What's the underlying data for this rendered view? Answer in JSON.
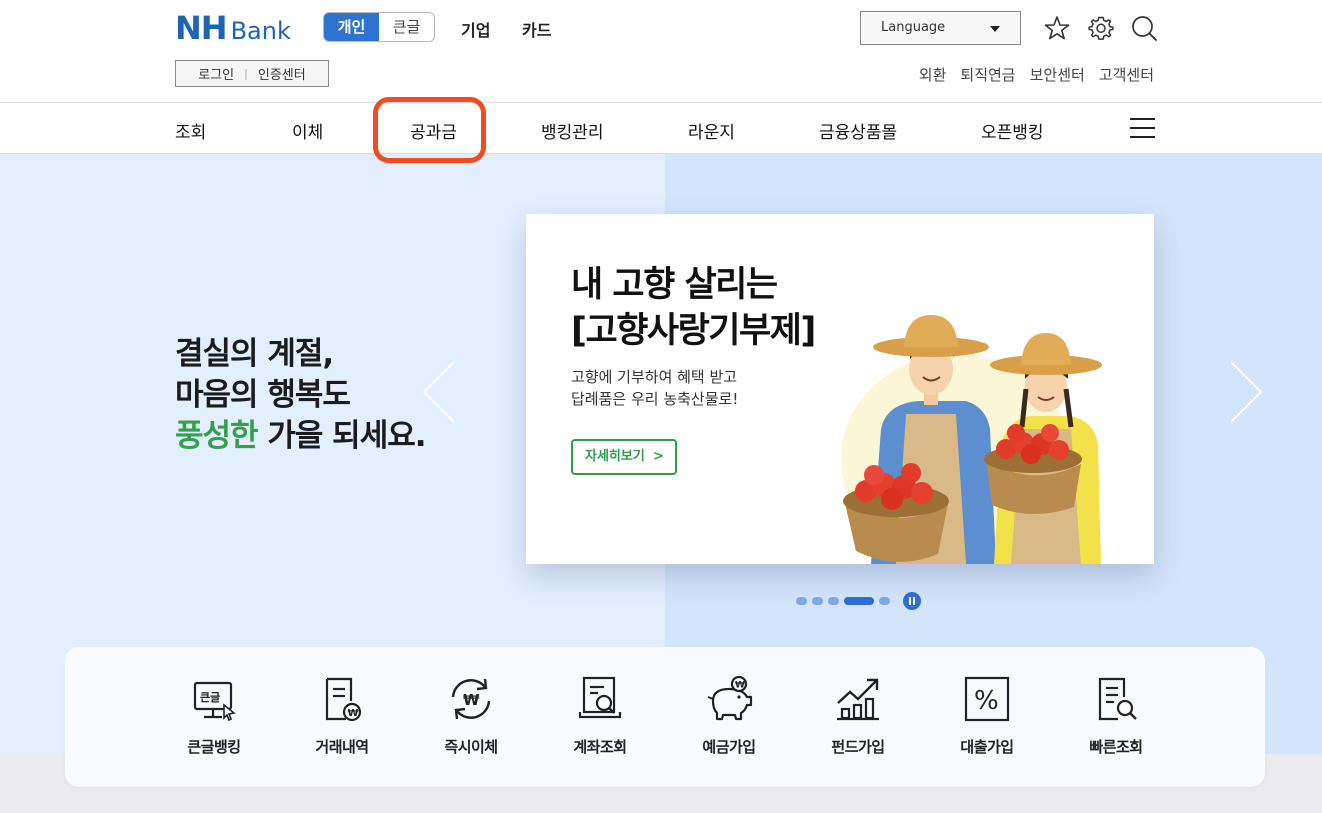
{
  "header": {
    "logo_nh": "NH",
    "logo_bank": "Bank",
    "segments": [
      {
        "label": "개인",
        "active": true
      },
      {
        "label": "큰글",
        "active": false
      }
    ],
    "top_links": [
      "기업",
      "카드"
    ],
    "language_label": "Language",
    "icons": [
      "star-icon",
      "gear-icon",
      "search-icon"
    ],
    "login_links": [
      "로그인",
      "인증센터"
    ],
    "util_links": [
      "외환",
      "퇴직연금",
      "보안센터",
      "고객센터"
    ]
  },
  "gnb": {
    "items": [
      "조회",
      "이체",
      "공과금",
      "뱅킹관리",
      "라운지",
      "금융상품몰",
      "오픈뱅킹"
    ],
    "highlighted": "공과금",
    "highlight_color": "#ee4d23",
    "menu_icon": "hamburger-icon"
  },
  "hero": {
    "copy_line1": "결실의 계절,",
    "copy_line2": "마음의 행복도",
    "copy_line3_green": "풍성한",
    "copy_line3_rest": " 가을 되세요.",
    "accent_green": "#33a14b",
    "prev_icon": "chevron-left-icon",
    "next_icon": "chevron-right-icon",
    "card": {
      "title_line1": "내 고향 살리는",
      "title_line2": "[고향사랑기부제]",
      "desc_line1": "고향에 기부하여 혜택 받고",
      "desc_line2": "답례품은 우리 농축산물로!",
      "button_label": "자세히보기",
      "button_chevron": ">"
    },
    "slider": {
      "total": 5,
      "current": 4,
      "pause_icon": "pause-icon"
    }
  },
  "quick_menu": [
    {
      "label": "큰글뱅킹",
      "icon": "large-text-monitor-icon",
      "icon_text": "큰글"
    },
    {
      "label": "거래내역",
      "icon": "transaction-document-icon",
      "icon_text": "₩"
    },
    {
      "label": "즉시이체",
      "icon": "instant-transfer-icon",
      "icon_text": "₩"
    },
    {
      "label": "계좌조회",
      "icon": "account-search-icon"
    },
    {
      "label": "예금가입",
      "icon": "piggy-bank-icon",
      "icon_text": "₩"
    },
    {
      "label": "펀드가입",
      "icon": "fund-chart-icon"
    },
    {
      "label": "대출가입",
      "icon": "loan-percent-icon",
      "icon_text": "%"
    },
    {
      "label": "빠른조회",
      "icon": "quick-search-document-icon"
    }
  ]
}
